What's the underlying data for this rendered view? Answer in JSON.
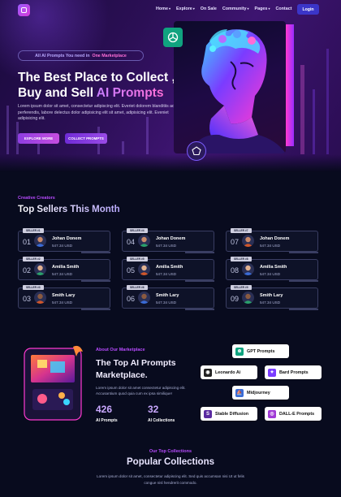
{
  "nav": {
    "items": [
      {
        "label": "Home",
        "caret": true
      },
      {
        "label": "Explore",
        "caret": true
      },
      {
        "label": "On Sale",
        "caret": false
      },
      {
        "label": "Community",
        "caret": true
      },
      {
        "label": "Pages",
        "caret": true
      },
      {
        "label": "Contact",
        "caret": false
      }
    ],
    "login": "Login"
  },
  "hero": {
    "pill_prefix": "All AI Prompts You need in",
    "pill_highlight": "One Marketplace",
    "title_line1": "The Best Place to Collect ,",
    "title_line2_plain": "Buy and Sell",
    "title_line2_grad": "AI Prompts",
    "lead": "Lorem ipsum dolor sit amet, consectetur adipiscing elit. Everiet dolorem blanditiis ad perferendis, labore delectus dolor adipisicing elit sit amet, adipisicing elit. Eveniet adipisicing elit.",
    "btn_explore": "EXPLORE MORE",
    "btn_collect": "COLLECT PROMPTS"
  },
  "sellers": {
    "label": "Creative Creators",
    "title": "Top Sellers This Month",
    "cards": [
      {
        "tag": "SELLER #1",
        "num": "01",
        "name": "Johan Donem",
        "price": "547.34 USD"
      },
      {
        "tag": "SELLER #4",
        "num": "04",
        "name": "Johan Donem",
        "price": "547.34 USD"
      },
      {
        "tag": "SELLER #7",
        "num": "07",
        "name": "Johan Donem",
        "price": "547.34 USD"
      },
      {
        "tag": "SELLER #2",
        "num": "02",
        "name": "Amilia Smith",
        "price": "547.34 USD"
      },
      {
        "tag": "SELLER #5",
        "num": "05",
        "name": "Amilia Smith",
        "price": "547.34 USD"
      },
      {
        "tag": "SELLER #8",
        "num": "08",
        "name": "Amilia Smith",
        "price": "547.34 USD"
      },
      {
        "tag": "SELLER #3",
        "num": "03",
        "name": "Smith Lary",
        "price": "547.34 USD"
      },
      {
        "tag": "SELLER #6",
        "num": "06",
        "name": "Smith Lary",
        "price": "547.34 USD"
      },
      {
        "tag": "SELLER #9",
        "num": "09",
        "name": "Smith Lary",
        "price": "547.34 USD"
      }
    ]
  },
  "marketplace": {
    "label": "About Our Marketplace",
    "title": "The Top AI Prompts Marketplace.",
    "lead": "Lorem ipsum dolor sit amet consectetur adipiscing elit. Accusantium quod quia cum ex ipsa similique!",
    "stat1_value": "426",
    "stat1_label": "AI Prompts",
    "stat2_value": "32",
    "stat2_label": "AI Collections",
    "chips": {
      "gpt": "GPT Prompts",
      "leonardo": "Leonardo Ai",
      "bard": "Bard Prompts",
      "midjourney": "Midjourney",
      "stable": "Stable Diffusion",
      "dalle": "DALL-E Prompts"
    }
  },
  "popular": {
    "label": "Our Top Collections",
    "title": "Popular Collections",
    "lead": "Lorem ipsum dolor sit amet, consectetur adipiscing elit. Sed quis accumsan nisi Ut ut felis congue nisl hendrerit commodo."
  }
}
